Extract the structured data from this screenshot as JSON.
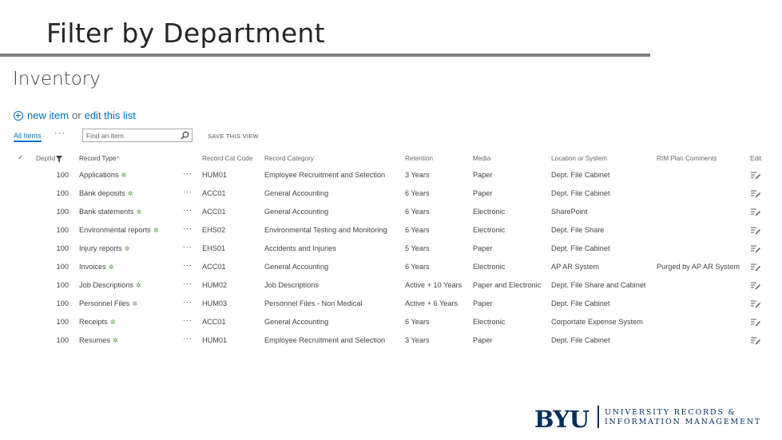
{
  "slide": {
    "title": "Filter by Department"
  },
  "list": {
    "title": "Inventory",
    "new_item": "new item",
    "or_text": "or",
    "edit_list": "edit this list",
    "view_all": "All Items",
    "more": "···",
    "search_placeholder": "Find an item",
    "save_view": "SAVE THIS VIEW"
  },
  "grid": {
    "headers": {
      "check": "✓",
      "dept": "DeptId",
      "type": "Record Type",
      "code": "Record Cat Code",
      "cat": "Record Category",
      "ret": "Retention",
      "media": "Media",
      "loc": "Location or System",
      "rim": "RIM Plan Comments",
      "edit": "Edit"
    },
    "rows": [
      {
        "dept": "100",
        "type": "Applications",
        "code": "HUM01",
        "cat": "Employee Recruitment and Selection",
        "ret": "3 Years",
        "media": "Paper",
        "loc": "Dept. File Cabinet",
        "rim": ""
      },
      {
        "dept": "100",
        "type": "Bank deposits",
        "code": "ACC01",
        "cat": "General Accounting",
        "ret": "6 Years",
        "media": "Paper",
        "loc": "Dept. File Cabinet",
        "rim": ""
      },
      {
        "dept": "100",
        "type": "Bank statements",
        "code": "ACC01",
        "cat": "General Accounting",
        "ret": "6 Years",
        "media": "Electronic",
        "loc": "SharePoint",
        "rim": ""
      },
      {
        "dept": "100",
        "type": "Environmental reports",
        "code": "EHS02",
        "cat": "Environmental Testing and Monitoring",
        "ret": "6 Years",
        "media": "Electronic",
        "loc": "Dept. File Share",
        "rim": ""
      },
      {
        "dept": "100",
        "type": "Injury reports",
        "code": "EHS01",
        "cat": "Accidents and Injuries",
        "ret": "5 Years",
        "media": "Paper",
        "loc": "Dept. File Cabinet",
        "rim": ""
      },
      {
        "dept": "100",
        "type": "Invoices",
        "code": "ACC01",
        "cat": "General Accounting",
        "ret": "6 Years",
        "media": "Electronic",
        "loc": "AP AR System",
        "rim": "Purged by AP AR System"
      },
      {
        "dept": "100",
        "type": "Job Descriptions",
        "code": "HUM02",
        "cat": "Job Descriptions",
        "ret": "Active + 10 Years",
        "media": "Paper and Electronic",
        "loc": "Dept. File Share and Cabinet",
        "rim": ""
      },
      {
        "dept": "100",
        "type": "Personnel Files",
        "code": "HUM03",
        "cat": "Personnel Files - Non Medical",
        "ret": "Active + 6 Years",
        "media": "Paper",
        "loc": "Dept. File Cabinet",
        "rim": ""
      },
      {
        "dept": "100",
        "type": "Receipts",
        "code": "ACC01",
        "cat": "General Accounting",
        "ret": "6 Years",
        "media": "Electronic",
        "loc": "Corportate Expense System",
        "rim": ""
      },
      {
        "dept": "100",
        "type": "Resumes",
        "code": "HUM01",
        "cat": "Employee Recruitment and Selection",
        "ret": "3 Years",
        "media": "Paper",
        "loc": "Dept. File Cabinet",
        "rim": ""
      }
    ]
  },
  "logo": {
    "mark": "BYU",
    "line1": "UNIVERSITY RECORDS &",
    "line2": "INFORMATION MANAGEMENT"
  },
  "colors": {
    "link": "#0072c6",
    "new_badge": "#4d9a3c",
    "brand": "#002e5d"
  },
  "icons": {
    "new_item": "plus-circle-icon",
    "search": "search-icon",
    "filter": "filter-icon",
    "row_new": "new-item-badge-icon",
    "edit": "edit-icon"
  }
}
